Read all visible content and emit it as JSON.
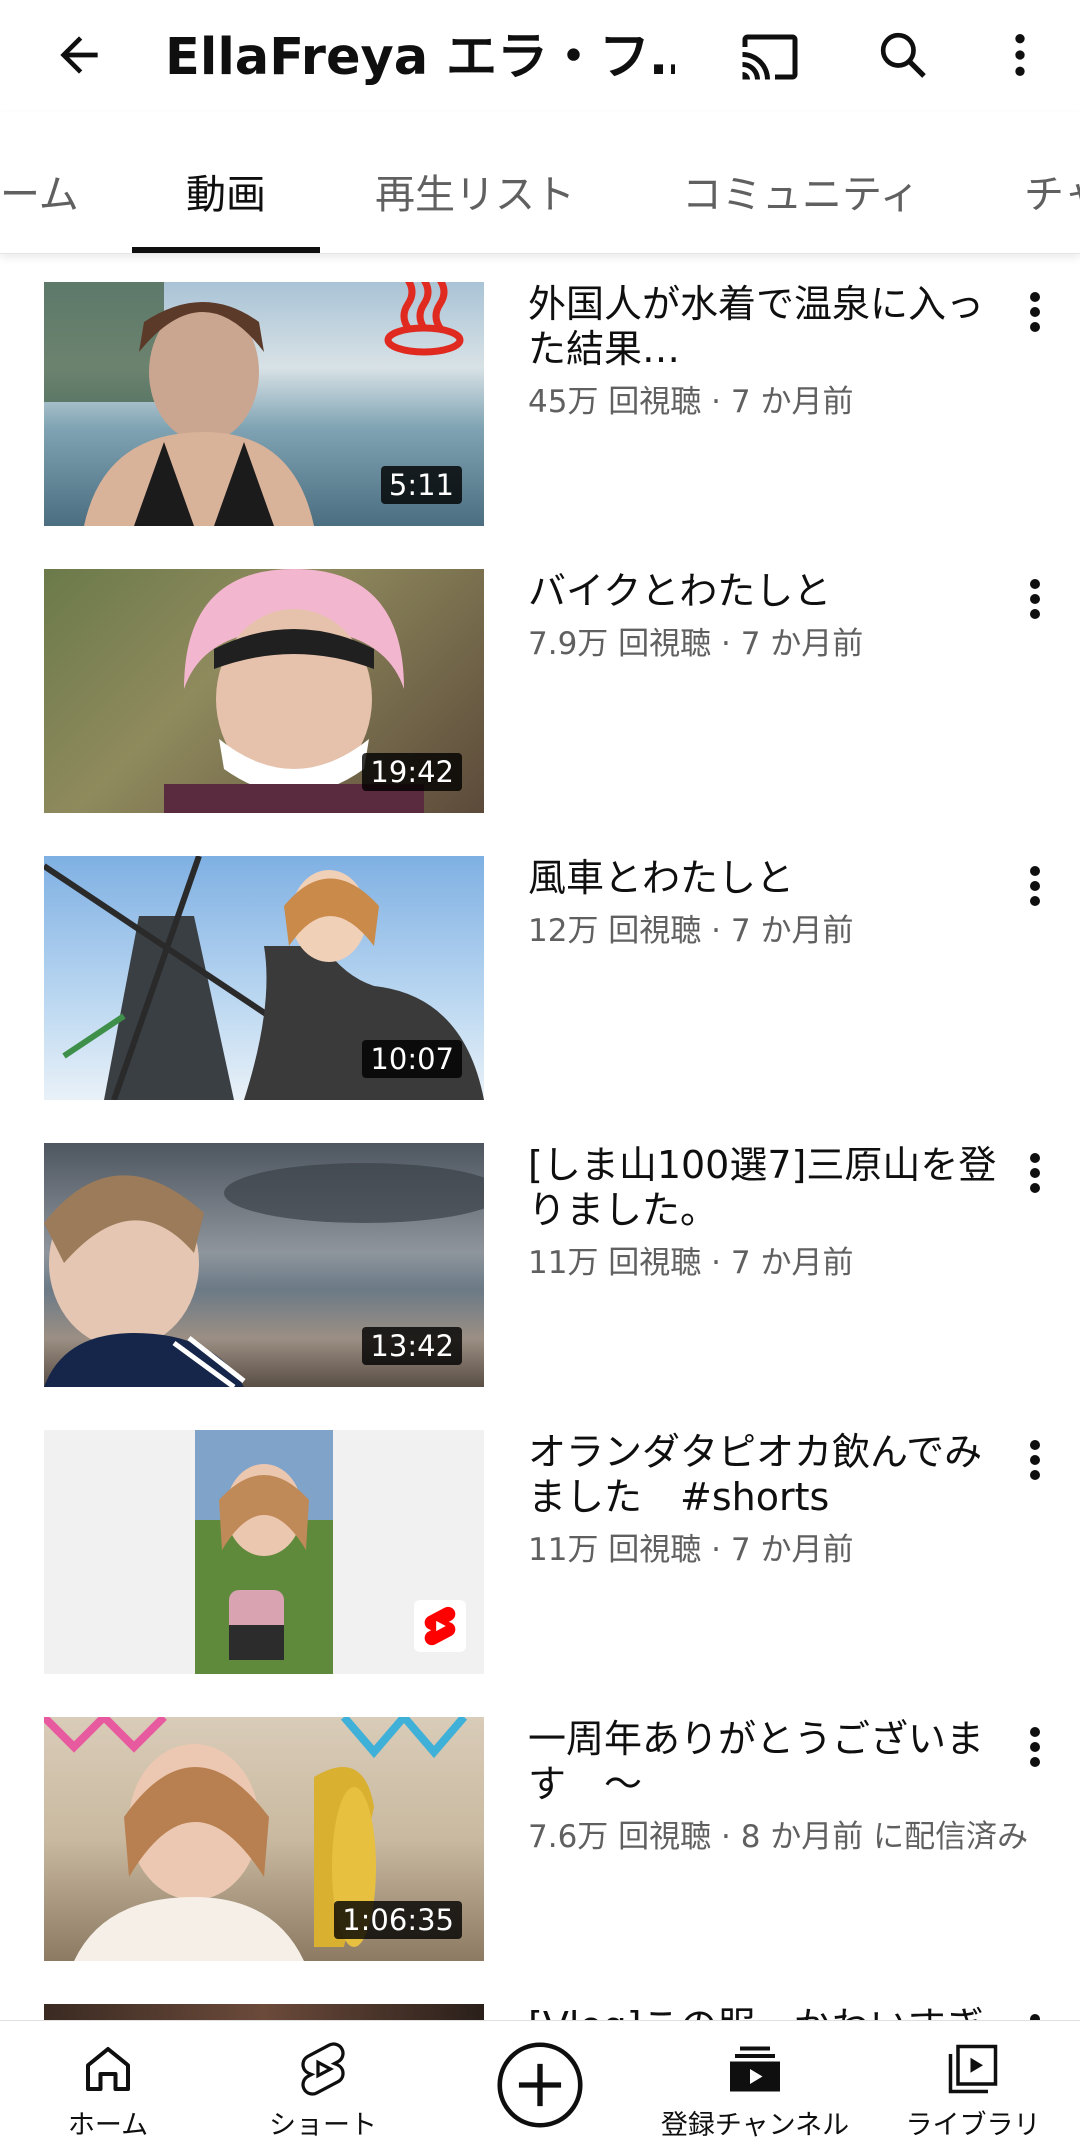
{
  "header": {
    "title": "EllaFreya エラ・フ…",
    "back_icon": "arrow-left-icon",
    "cast_icon": "cast-icon",
    "search_icon": "search-icon",
    "more_icon": "more-vert-icon"
  },
  "tabs": [
    {
      "label": "ーム",
      "active": false
    },
    {
      "label": "動画",
      "active": true
    },
    {
      "label": "再生リスト",
      "active": false
    },
    {
      "label": "コミュニティ",
      "active": false
    },
    {
      "label": "チャ",
      "active": false
    }
  ],
  "videos": [
    {
      "title": "外国人が水着で温泉に入った結果…",
      "meta": "45万 回視聴 · 7 か月前",
      "duration": "5:11"
    },
    {
      "title": "バイクとわたしと",
      "meta": "7.9万 回視聴 · 7 か月前",
      "duration": "19:42"
    },
    {
      "title": "風車とわたしと",
      "meta": "12万 回視聴 · 7 か月前",
      "duration": "10:07"
    },
    {
      "title": "[しま山100選7]三原山を登りました。",
      "meta": "11万 回視聴 · 7 か月前",
      "duration": "13:42"
    },
    {
      "title": "オランダタピオカ飲んでみました　#shorts",
      "meta": "11万 回視聴 · 7 か月前",
      "duration": ""
    },
    {
      "title": "一周年ありがとうございます　〜",
      "meta": "7.6万 回視聴 · 8 か月前 に配信済み",
      "duration": "1:06:35"
    },
    {
      "title": "[Vlog]この服、かわいすぎ",
      "meta": "",
      "duration": ""
    }
  ],
  "bottom_nav": [
    {
      "label": "ホーム",
      "icon": "home-icon"
    },
    {
      "label": "ショート",
      "icon": "shorts-icon"
    },
    {
      "label": "",
      "icon": "create-plus-icon"
    },
    {
      "label": "登録チャンネル",
      "icon": "subscriptions-icon"
    },
    {
      "label": "ライブラリ",
      "icon": "library-icon"
    }
  ],
  "colors": {
    "text_primary": "#0f0f0f",
    "text_secondary": "#606060",
    "shorts_red": "#ff0000"
  }
}
